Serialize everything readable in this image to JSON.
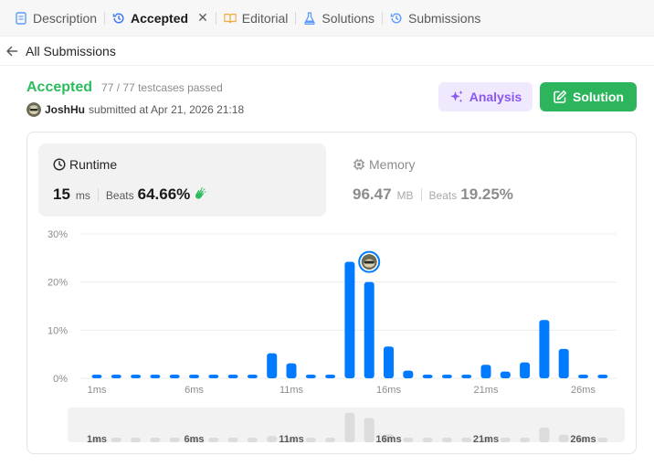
{
  "tabs": [
    {
      "label": "Description",
      "icon": "description-icon",
      "active": false
    },
    {
      "label": "Accepted",
      "icon": "history-icon",
      "active": true
    },
    {
      "label": "Editorial",
      "icon": "book-icon",
      "active": false
    },
    {
      "label": "Solutions",
      "icon": "flask-icon",
      "active": false
    },
    {
      "label": "Submissions",
      "icon": "history-icon",
      "active": false
    }
  ],
  "back": {
    "label": "All Submissions"
  },
  "submission": {
    "status": "Accepted",
    "testcases": "77 / 77 testcases passed",
    "user": "JoshHu",
    "submitted_text": "submitted at Apr 21, 2026 21:18"
  },
  "buttons": {
    "analysis": "Analysis",
    "solution": "Solution"
  },
  "runtime": {
    "title": "Runtime",
    "value": "15",
    "unit": "ms",
    "beats_label": "Beats",
    "beats": "64.66%"
  },
  "memory": {
    "title": "Memory",
    "value": "96.47",
    "unit": "MB",
    "beats_label": "Beats",
    "beats": "19.25%"
  },
  "colors": {
    "accepted": "#2cbb5d",
    "bar": "#007aff",
    "analysis_text": "#8a56f5",
    "solution_bg": "#2db55d"
  },
  "chart_data": {
    "type": "bar",
    "ylabel_ticks": [
      "0%",
      "10%",
      "20%",
      "30%"
    ],
    "ylim": [
      0,
      30
    ],
    "x_tick_labels": [
      "1ms",
      "6ms",
      "11ms",
      "16ms",
      "21ms",
      "26ms"
    ],
    "categories": [
      "1ms",
      "2ms",
      "3ms",
      "4ms",
      "5ms",
      "6ms",
      "7ms",
      "8ms",
      "9ms",
      "10ms",
      "11ms",
      "12ms",
      "13ms",
      "14ms",
      "15ms",
      "16ms",
      "17ms",
      "18ms",
      "19ms",
      "20ms",
      "21ms",
      "22ms",
      "23ms",
      "24ms",
      "25ms",
      "26ms",
      "27ms"
    ],
    "values": [
      0.6,
      0.6,
      0.6,
      0.6,
      0.6,
      0.6,
      0.6,
      0.6,
      0.6,
      5.2,
      3.1,
      0.6,
      0.6,
      24.2,
      20.0,
      6.6,
      1.6,
      0.6,
      0.6,
      0.6,
      2.8,
      1.4,
      3.3,
      12.1,
      6.1,
      0.6,
      0.6
    ],
    "highlight_category": "15ms",
    "grid": true
  }
}
